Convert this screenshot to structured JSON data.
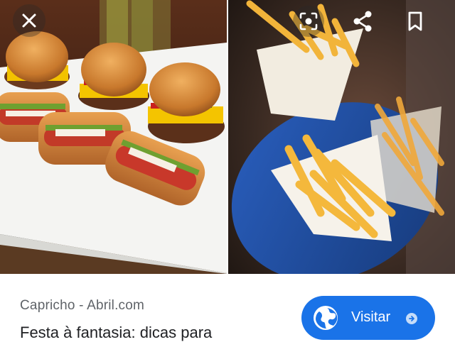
{
  "image_viewer": {
    "controls": {
      "close_icon": "close-icon",
      "lens_icon": "lens-icon",
      "share_icon": "share-icon",
      "bookmark_icon": "bookmark-icon"
    },
    "images": [
      {
        "subject": "mini-burgers-and-hot-dogs"
      },
      {
        "subject": "french-fries-cones"
      }
    ]
  },
  "result": {
    "source": "Capricho - Abril.com",
    "title": "Festa à fantasia: dicas para",
    "visit_button": {
      "label": "Visitar",
      "icon": "globe-icon",
      "trailing_icon": "arrow-circle-icon",
      "color": "#1a73e8"
    }
  }
}
